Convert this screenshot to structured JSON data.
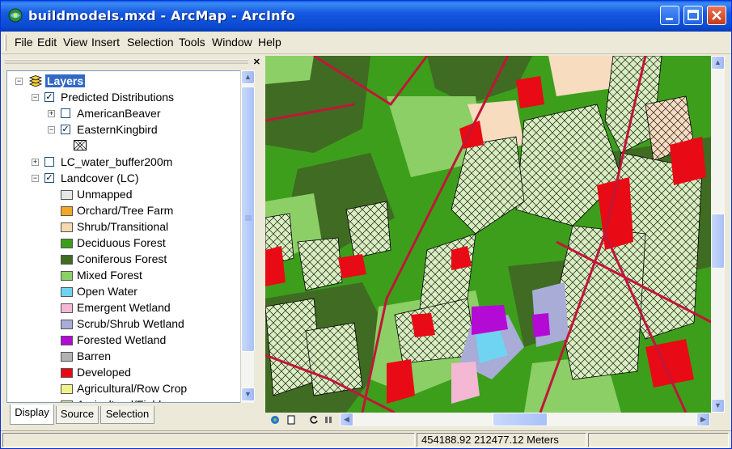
{
  "window": {
    "title": "buildmodels.mxd - ArcMap - ArcInfo",
    "controls": [
      "minimize",
      "maximize",
      "close"
    ]
  },
  "menubar": {
    "items": [
      "File",
      "Edit",
      "View",
      "Insert",
      "Selection",
      "Tools",
      "Window",
      "Help"
    ]
  },
  "toc": {
    "root": {
      "label": "Layers",
      "icon": "layers-icon"
    },
    "groups": [
      {
        "label": "Predicted Distributions",
        "checked": true,
        "expanded": true,
        "children": [
          {
            "label": "AmericanBeaver",
            "checked": false,
            "expanded": false
          },
          {
            "label": "EasternKingbird",
            "checked": true,
            "expanded": true
          }
        ]
      },
      {
        "label": "LC_water_buffer200m",
        "checked": false,
        "expanded": false
      },
      {
        "label": "Landcover (LC)",
        "checked": true,
        "expanded": true
      }
    ],
    "legend": [
      {
        "label": "Unmapped",
        "color": "#e6e6e6"
      },
      {
        "label": "Orchard/Tree Farm",
        "color": "#f5a623"
      },
      {
        "label": "Shrub/Transitional",
        "color": "#f7d9b1"
      },
      {
        "label": "Deciduous Forest",
        "color": "#3d9e1c"
      },
      {
        "label": "Coniferous Forest",
        "color": "#3f6b22"
      },
      {
        "label": "Mixed Forest",
        "color": "#8ccf66"
      },
      {
        "label": "Open Water",
        "color": "#6fd4f2"
      },
      {
        "label": "Emergent Wetland",
        "color": "#f5b8d4"
      },
      {
        "label": "Scrub/Shrub Wetland",
        "color": "#a8acd6"
      },
      {
        "label": "Forested Wetland",
        "color": "#b40ad6"
      },
      {
        "label": "Barren",
        "color": "#b2b2b2"
      },
      {
        "label": "Developed",
        "color": "#e80a14"
      },
      {
        "label": "Agricultural/Row Crop",
        "color": "#f2f28c"
      },
      {
        "label": "Agricultural/Field",
        "color": "#d9ef97"
      }
    ],
    "tabs": [
      "Display",
      "Source",
      "Selection"
    ],
    "active_tab": "Display"
  },
  "status": {
    "coordinates": "454188.92  212477.12 Meters"
  }
}
